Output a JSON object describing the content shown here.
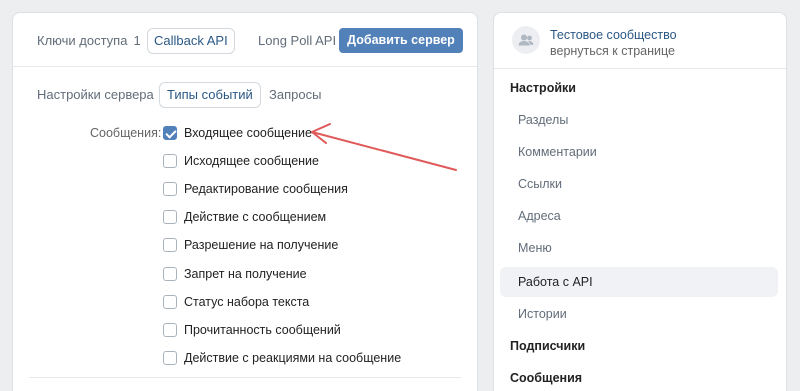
{
  "top_tabs": {
    "keys_label": "Ключи доступа",
    "keys_count": "1",
    "callback_label": "Callback API",
    "longpoll_label": "Long Poll API",
    "add_server_label": "Добавить сервер"
  },
  "sub_tabs": {
    "server_settings": "Настройки сервера",
    "event_types": "Типы событий",
    "requests": "Запросы"
  },
  "events": {
    "group_label": "Сообщения:",
    "items": [
      {
        "label": "Входящее сообщение",
        "checked": true
      },
      {
        "label": "Исходящее сообщение",
        "checked": false
      },
      {
        "label": "Редактирование сообщения",
        "checked": false
      },
      {
        "label": "Действие с сообщением",
        "checked": false
      },
      {
        "label": "Разрешение на получение",
        "checked": false
      },
      {
        "label": "Запрет на получение",
        "checked": false
      },
      {
        "label": "Статус набора текста",
        "checked": false
      },
      {
        "label": "Прочитанность сообщений",
        "checked": false
      },
      {
        "label": "Действие с реакциями на сообщение",
        "checked": false
      }
    ]
  },
  "community": {
    "name": "Тестовое сообщество",
    "back_link": "вернуться к странице",
    "avatar_icon": "community-users-icon"
  },
  "side_menu": {
    "items": [
      {
        "label": "Настройки",
        "section": true
      },
      {
        "label": "Разделы"
      },
      {
        "label": "Комментарии"
      },
      {
        "label": "Ссылки"
      },
      {
        "label": "Адреса"
      },
      {
        "label": "Меню"
      },
      {
        "label": "Работа с API",
        "active": true
      },
      {
        "label": "Истории"
      },
      {
        "label": "Подписчики",
        "section": true
      },
      {
        "label": "Сообщения",
        "section": true
      }
    ]
  },
  "annotation": {
    "arrow_color": "#e05a5a"
  },
  "colors": {
    "accent": "#5181b8",
    "link": "#2a5885",
    "background": "#edeef0"
  }
}
